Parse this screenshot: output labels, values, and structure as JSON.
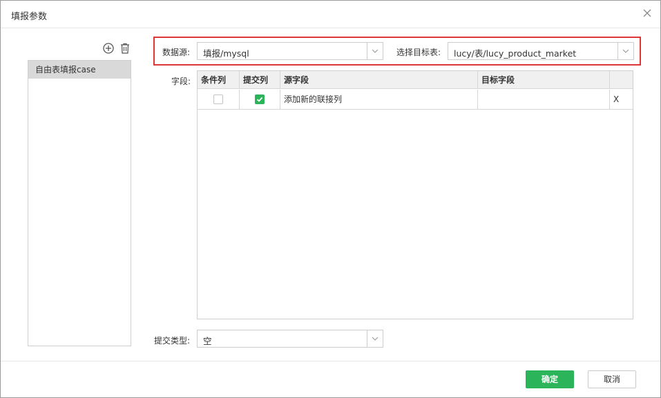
{
  "dialog": {
    "title": "填报参数"
  },
  "case_list": {
    "items": [
      {
        "label": "自由表填报case"
      }
    ]
  },
  "datasource": {
    "label": "数据源:",
    "value": "填报/mysql"
  },
  "target_table": {
    "label": "选择目标表:",
    "value": "lucy/表/lucy_product_market"
  },
  "fields": {
    "label": "字段:",
    "columns": [
      "条件列",
      "提交列",
      "源字段",
      "目标字段",
      ""
    ],
    "rows": [
      {
        "condition": false,
        "submit": true,
        "source": "添加新的联接列",
        "target": "",
        "remove": "X"
      }
    ]
  },
  "submit_type": {
    "label": "提交类型:",
    "value": "空"
  },
  "footer": {
    "ok_label": "确定",
    "cancel_label": "取消"
  },
  "colors": {
    "accent_green": "#2bb45a",
    "highlight_red": "#e03636",
    "selected_item_bg": "#d9d9d9"
  }
}
